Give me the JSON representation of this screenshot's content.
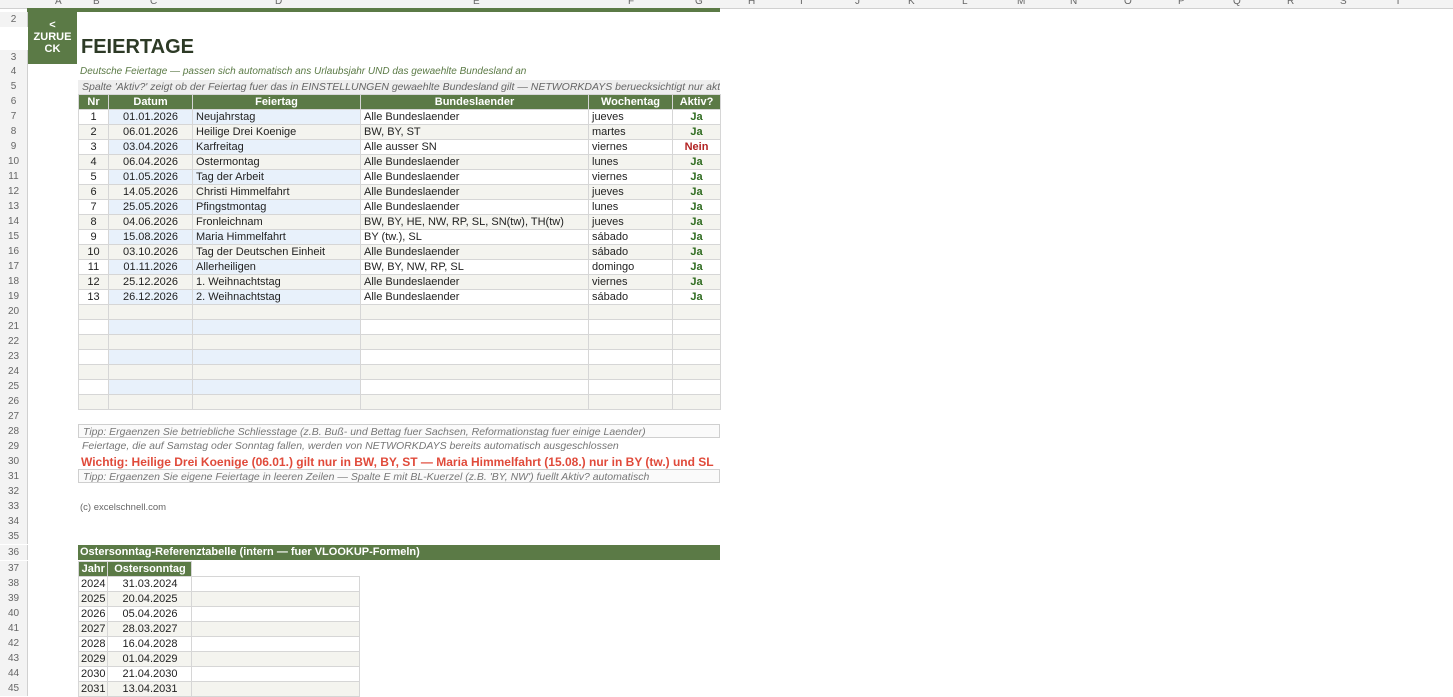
{
  "sheet": {
    "back_button": "< ZURUECK",
    "back_line1": "<",
    "back_line2": "ZURUE",
    "back_line3": "CK",
    "title": "FEIERTAGE",
    "subtitle": "Deutsche Feiertage — passen sich automatisch ans Urlaubsjahr UND das gewaehlte Bundesland an",
    "note_row5": "Spalte 'Aktiv?' zeigt ob der Feiertag fuer das in EINSTELLUNGEN gewaehlte Bundesland gilt — NETWORKDAYS beruecksichtigt nur aktive",
    "column_letters": [
      "A",
      "B",
      "C",
      "D",
      "E",
      "F",
      "G",
      "H",
      "I",
      "J",
      "K",
      "L",
      "M",
      "N",
      "O",
      "P",
      "Q",
      "R",
      "S",
      "T"
    ],
    "row_numbers": [
      "2",
      "3",
      "4",
      "5",
      "6",
      "7",
      "8",
      "9",
      "10",
      "11",
      "12",
      "13",
      "14",
      "15",
      "16",
      "17",
      "18",
      "19",
      "20",
      "21",
      "22",
      "23",
      "24",
      "25",
      "26",
      "27",
      "28",
      "29",
      "30",
      "31",
      "32",
      "33",
      "34",
      "35",
      "36",
      "37",
      "38",
      "39",
      "40",
      "41",
      "42",
      "43",
      "44",
      "45"
    ]
  },
  "holidays": {
    "headers": [
      "Nr",
      "Datum",
      "Feiertag",
      "Bundeslaender",
      "Wochentag",
      "Aktiv?"
    ],
    "rows": [
      {
        "nr": "1",
        "datum": "01.01.2026",
        "feiertag": "Neujahrstag",
        "bl": "Alle Bundeslaender",
        "tag": "jueves",
        "aktiv": "Ja"
      },
      {
        "nr": "2",
        "datum": "06.01.2026",
        "feiertag": "Heilige Drei Koenige",
        "bl": "BW, BY, ST",
        "tag": "martes",
        "aktiv": "Ja"
      },
      {
        "nr": "3",
        "datum": "03.04.2026",
        "feiertag": "Karfreitag",
        "bl": "Alle ausser SN",
        "tag": "viernes",
        "aktiv": "Nein"
      },
      {
        "nr": "4",
        "datum": "06.04.2026",
        "feiertag": "Ostermontag",
        "bl": "Alle Bundeslaender",
        "tag": "lunes",
        "aktiv": "Ja"
      },
      {
        "nr": "5",
        "datum": "01.05.2026",
        "feiertag": "Tag der Arbeit",
        "bl": "Alle Bundeslaender",
        "tag": "viernes",
        "aktiv": "Ja"
      },
      {
        "nr": "6",
        "datum": "14.05.2026",
        "feiertag": "Christi Himmelfahrt",
        "bl": "Alle Bundeslaender",
        "tag": "jueves",
        "aktiv": "Ja"
      },
      {
        "nr": "7",
        "datum": "25.05.2026",
        "feiertag": "Pfingstmontag",
        "bl": "Alle Bundeslaender",
        "tag": "lunes",
        "aktiv": "Ja"
      },
      {
        "nr": "8",
        "datum": "04.06.2026",
        "feiertag": "Fronleichnam",
        "bl": "BW, BY, HE, NW, RP, SL, SN(tw), TH(tw)",
        "tag": "jueves",
        "aktiv": "Ja"
      },
      {
        "nr": "9",
        "datum": "15.08.2026",
        "feiertag": "Maria Himmelfahrt",
        "bl": "BY (tw.), SL",
        "tag": "sábado",
        "aktiv": "Ja"
      },
      {
        "nr": "10",
        "datum": "03.10.2026",
        "feiertag": "Tag der Deutschen Einheit",
        "bl": "Alle Bundeslaender",
        "tag": "sábado",
        "aktiv": "Ja"
      },
      {
        "nr": "11",
        "datum": "01.11.2026",
        "feiertag": "Allerheiligen",
        "bl": "BW, BY, NW, RP, SL",
        "tag": "domingo",
        "aktiv": "Ja"
      },
      {
        "nr": "12",
        "datum": "25.12.2026",
        "feiertag": "1. Weihnachtstag",
        "bl": "Alle Bundeslaender",
        "tag": "viernes",
        "aktiv": "Ja"
      },
      {
        "nr": "13",
        "datum": "26.12.2026",
        "feiertag": "2. Weihnachtstag",
        "bl": "Alle Bundeslaender",
        "tag": "sábado",
        "aktiv": "Ja"
      }
    ],
    "empty_rows": 7
  },
  "tips": {
    "tip1": "Tipp: Ergaenzen Sie betriebliche Schliesstage (z.B. Buß- und Bettag fuer Sachsen, Reformationstag fuer einige Laender)",
    "tip2": "Feiertage, die auf Samstag oder Sonntag fallen, werden von NETWORKDAYS bereits automatisch ausgeschlossen",
    "warning": "Wichtig: Heilige Drei Koenige (06.01.) gilt nur in BW, BY, ST — Maria Himmelfahrt (15.08.) nur in BY (tw.) und SL",
    "tip3": "Tipp: Ergaenzen Sie eigene Feiertage in leeren Zeilen — Spalte E mit BL-Kuerzel (z.B. 'BY, NW') fuellt Aktiv? automatisch",
    "copyright": "(c) excelschnell.com"
  },
  "easter": {
    "title": "Ostersonntag-Referenztabelle (intern — fuer VLOOKUP-Formeln)",
    "headers": [
      "Jahr",
      "Ostersonntag"
    ],
    "rows": [
      {
        "jahr": "2024",
        "datum": "31.03.2024"
      },
      {
        "jahr": "2025",
        "datum": "20.04.2025"
      },
      {
        "jahr": "2026",
        "datum": "05.04.2026"
      },
      {
        "jahr": "2027",
        "datum": "28.03.2027"
      },
      {
        "jahr": "2028",
        "datum": "16.04.2028"
      },
      {
        "jahr": "2029",
        "datum": "01.04.2029"
      },
      {
        "jahr": "2030",
        "datum": "21.04.2030"
      },
      {
        "jahr": "2031",
        "datum": "13.04.2031"
      }
    ]
  },
  "colors": {
    "accent": "#5b7a46",
    "active": "#2e6b1f",
    "inactive": "#b22222",
    "warning": "#e04a3a"
  }
}
